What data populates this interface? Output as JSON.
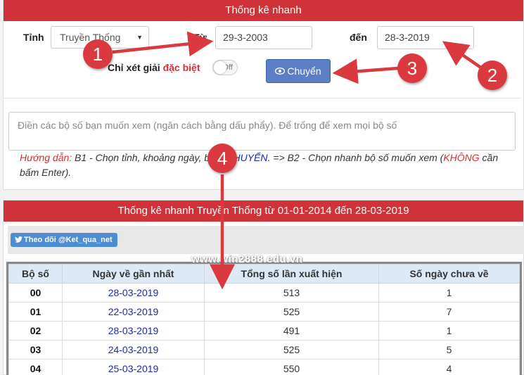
{
  "panel1": {
    "title": "Thống kê nhanh",
    "province_label": "Tỉnh",
    "province_value": "Truyền Thống",
    "from_label": "Từ",
    "from_value": "29-3-2003",
    "to_label": "đến",
    "to_value": "28-3-2019",
    "special_prefix": "Chỉ xét giải ",
    "special_red": "đặc biệt",
    "toggle_label": "Off",
    "go_button": "Chuyển",
    "search_placeholder": "Điền các bộ số bạn muốn xem (ngăn cách bằng dấu phẩy). Để trống để xem mọi bộ số",
    "guide": {
      "p1": "Hướng dẫn:",
      "p2": " B1 - Chọn tỉnh, khoảng ngày, bấm ",
      "p3": "CHUYỂN",
      "p4": ". => B2 - Chọn nhanh bộ số muốn xem (",
      "p5": "KHÔNG",
      "p6": " cần bấm Enter)."
    }
  },
  "panel2": {
    "title": "Thống kê nhanh Truyền Thống từ 01-01-2014 đến 28-03-2019",
    "twitter_button": "Theo dõi @Ket_qua_net",
    "columns": [
      "Bộ số",
      "Ngày về gần nhất",
      "Tổng số lần xuất hiện",
      "Số ngày chưa về"
    ],
    "rows": [
      {
        "num": "00",
        "date": "28-03-2019",
        "total": "513",
        "days": "1"
      },
      {
        "num": "01",
        "date": "22-03-2019",
        "total": "525",
        "days": "7"
      },
      {
        "num": "02",
        "date": "28-03-2019",
        "total": "491",
        "days": "1"
      },
      {
        "num": "03",
        "date": "24-03-2019",
        "total": "525",
        "days": "5"
      },
      {
        "num": "04",
        "date": "25-03-2019",
        "total": "550",
        "days": "4"
      }
    ]
  },
  "watermark": "www.win2888.edu.vn",
  "annotations": [
    "1",
    "2",
    "3",
    "4"
  ],
  "colors": {
    "header_red": "#d0323a",
    "button_blue": "#5b7ec4",
    "link_blue": "#1b2bb5",
    "badge_red": "#d9393f"
  }
}
